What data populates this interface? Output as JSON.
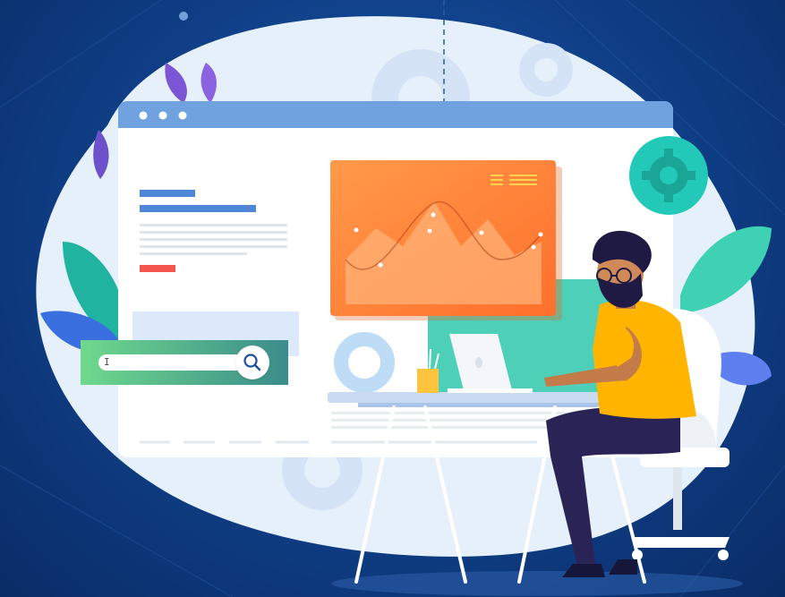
{
  "scene": {
    "kind": "illustration",
    "colors": {
      "background": "#0f3e86",
      "blob": "#e6f0fb",
      "window_bar": "#6fa2de",
      "window_body": "#ffffff",
      "accent_orange": "#ff8a3d",
      "accent_teal": "#22c9b8",
      "search_green": "#5dd08a",
      "shirt_yellow": "#ffb400",
      "plant_teal": "#1fb3a0",
      "plant_blue": "#3a6fe0"
    },
    "icons": {
      "search": "search-icon",
      "gear": "gear-icon",
      "window_dots": "window-control-dots"
    },
    "search": {
      "value": "I"
    }
  }
}
